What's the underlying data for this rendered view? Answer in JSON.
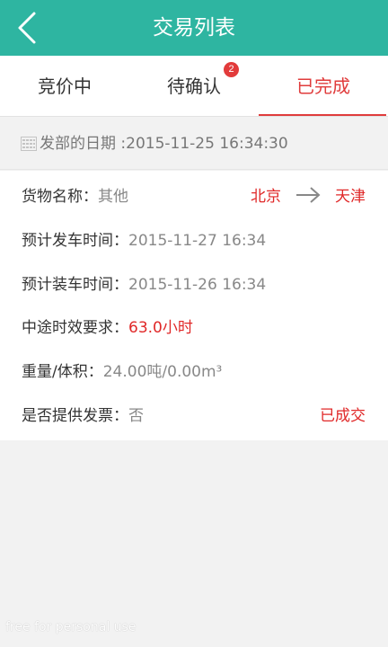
{
  "header": {
    "title": "交易列表",
    "back_icon": "chevron-left-icon"
  },
  "tabs": [
    {
      "label": "竞价中",
      "active": false
    },
    {
      "label": "待确认",
      "badge": "2",
      "active": false
    },
    {
      "label": "已完成",
      "active": true
    }
  ],
  "date_bar": {
    "icon": "calendar-icon",
    "text": "发部的日期 :2015-11-25 16:34:30"
  },
  "record": {
    "cargo_label": "货物名称：",
    "cargo_value": "其他",
    "route_from": "北京",
    "route_to": "天津",
    "route_icon": "arrow-right-icon",
    "depart_label": "预计发车时间：",
    "depart_value": "2015-11-27 16:34",
    "load_label": "预计装车时间：",
    "load_value": "2015-11-26 16:34",
    "transit_label": "中途时效要求：",
    "transit_value": "63.0小时",
    "weight_label": "重量/体积：",
    "weight_value": "24.00吨/0.00m³",
    "invoice_label": "是否提供发票：",
    "invoice_value": "否",
    "status": "已成交"
  },
  "watermark": "free for personal use",
  "colors": {
    "header_bg": "#2eb5a1",
    "accent_red": "#e02828",
    "badge_red": "#e23b3b"
  }
}
